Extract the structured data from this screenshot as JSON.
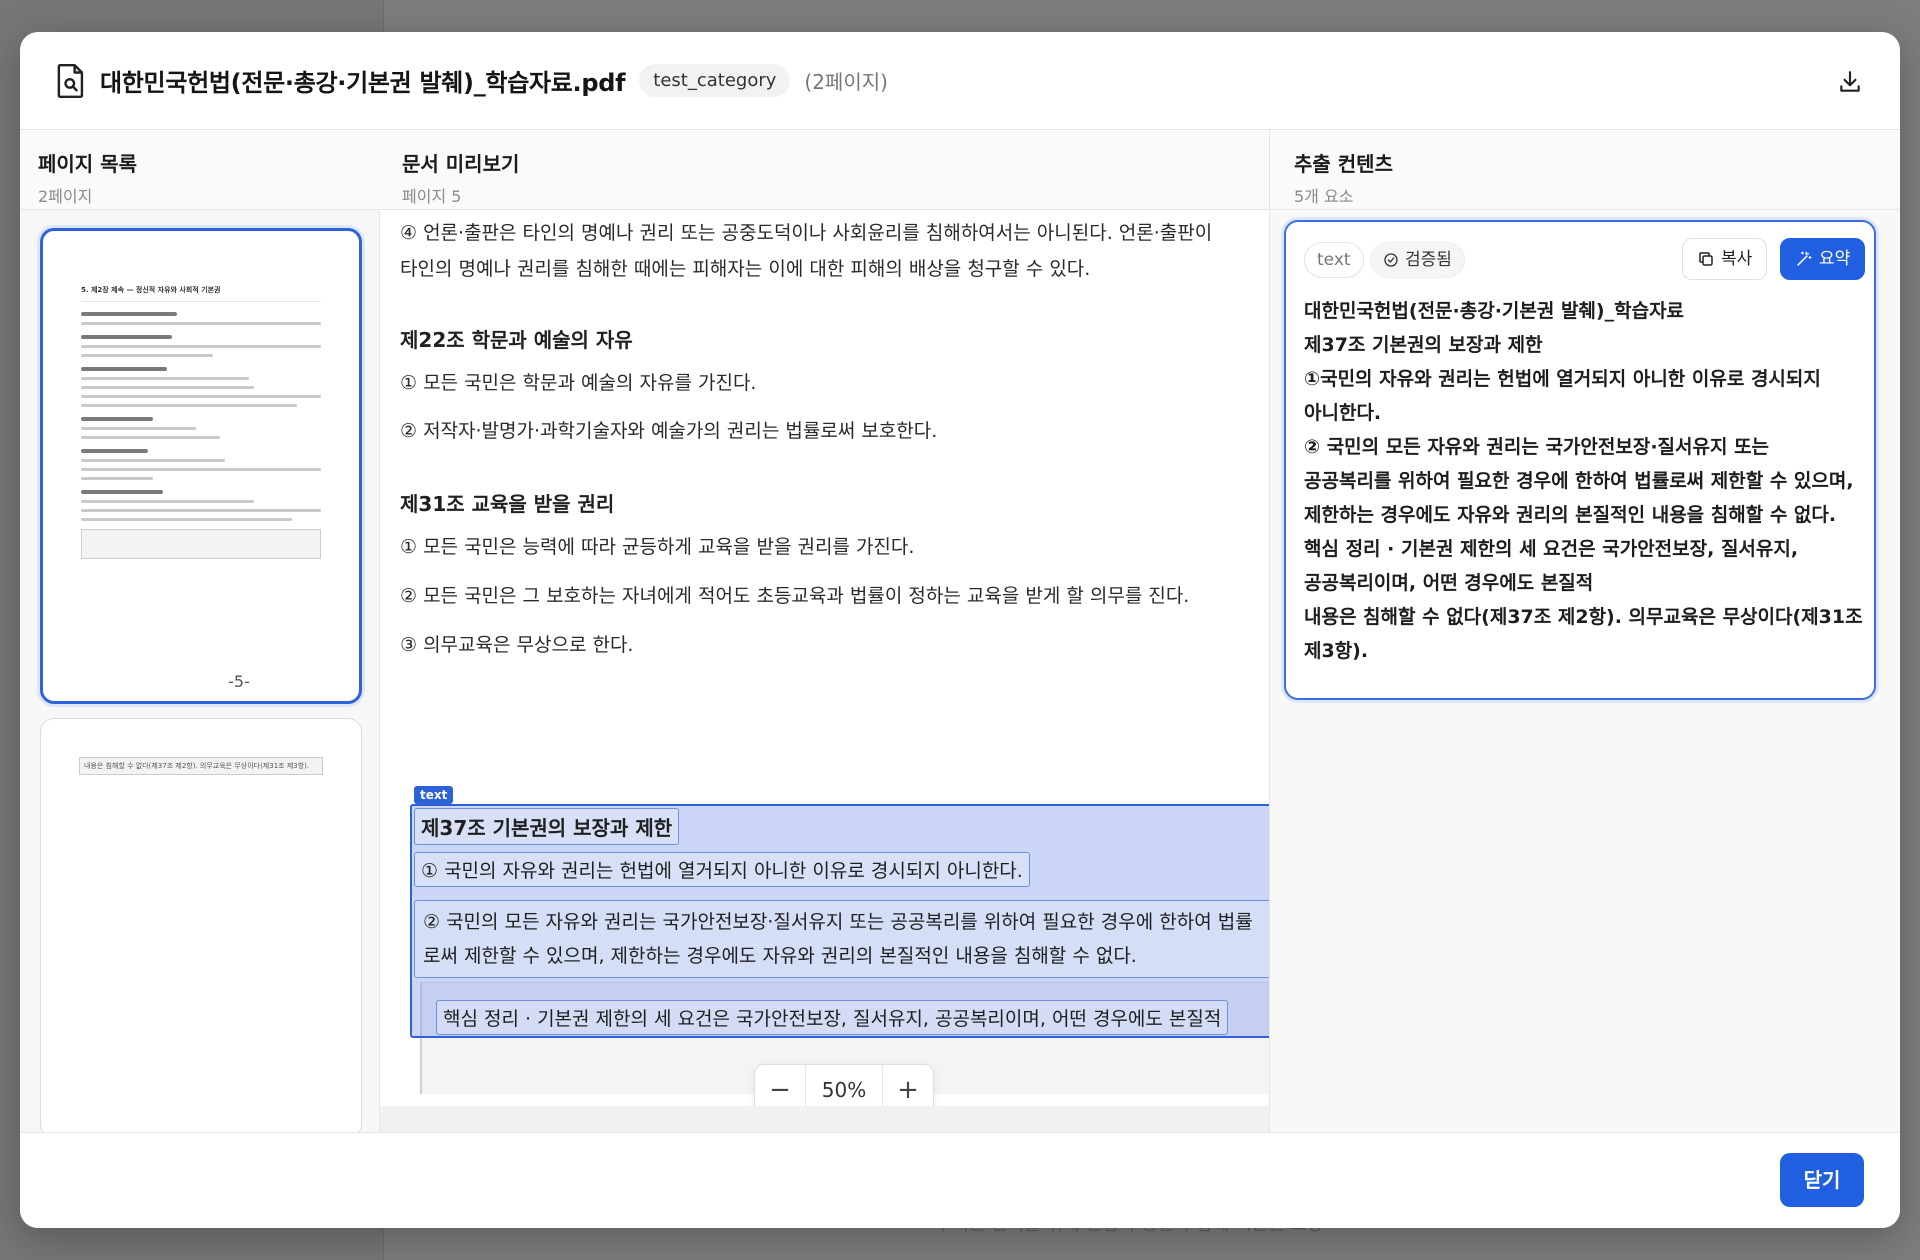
{
  "backdrop": {
    "bottom_text": "이 기본 원리를 위해 헌법의 정신과 함께 기본권 보장"
  },
  "header": {
    "file_title": "대한민국헌법(전문·총강·기본권 발췌)_학습자료.pdf",
    "category": "test_category",
    "page_count": "(2페이지)"
  },
  "left": {
    "title": "페이지 목록",
    "subtitle": "2페이지",
    "thumbs": [
      {
        "page_label": "-5-",
        "heading": "5. 제2장 제속 — 정신적 자유와 사회적 기본권"
      },
      {
        "caption": "내용은 침해할 수 없다(제37조 제2항). 의무교육은 무상이다(제31조 제3항)."
      }
    ]
  },
  "middle": {
    "title": "문서 미리보기",
    "subtitle": "페이지 5",
    "lines": {
      "l1": "④ 언론·출판은 타인의 명예나 권리 또는 공중도덕이나 사회윤리를 침해하여서는 아니된다. 언론·출판이",
      "l2": "타인의 명예나 권리를 침해한 때에는 피해자는 이에 대한 피해의 배상을 청구할 수 있다.",
      "a22": "제22조 학문과 예술의 자유",
      "a22_1": "① 모든 국민은 학문과 예술의 자유를 가진다.",
      "a22_2": "② 저작자·발명가·과학기술자와 예술가의 권리는 법률로써 보호한다.",
      "a31": "제31조 교육을 받을 권리",
      "a31_1": "① 모든 국민은 능력에 따라 균등하게 교육을 받을 권리를 가진다.",
      "a31_2": "② 모든 국민은 그 보호하는 자녀에게 적어도 초등교육과 법률이 정하는 교육을 받게 할 의무를 진다.",
      "a31_3": "③ 의무교육은 무상으로 한다.",
      "sel_tag": "text",
      "a37": "제37조 기본권의 보장과 제한",
      "a37_1": "① 국민의 자유와 권리는 헌법에 열거되지 아니한 이유로 경시되지 아니한다.",
      "a37_2a": "② 국민의 모든 자유와 권리는 국가안전보장·질서유지 또는 공공복리를 위하여 필요한 경우에 한하여 법률",
      "a37_2b": "로써 제한할 수 있으며, 제한하는 경우에도 자유와 권리의 본질적인 내용을 침해할 수 없다.",
      "callout": "핵심 정리 · 기본권 제한의 세 요건은 국가안전보장, 질서유지, 공공복리이며, 어떤 경우에도 본질적"
    },
    "zoom": {
      "minus": "−",
      "value": "50%",
      "plus": "+"
    }
  },
  "right": {
    "title": "추출 컨텐츠",
    "subtitle": "5개 요소",
    "card": {
      "type_chip": "text",
      "verified_chip": "검증됨",
      "copy_label": "복사",
      "summary_label": "요약",
      "content": [
        "대한민국헌법(전문·총강·기본권 발췌)_학습자료",
        "제37조 기본권의 보장과 제한",
        "①국민의 자유와 권리는 헌법에 열거되지 아니한 이유로 경시되지",
        "아니한다.",
        "② 국민의 모든 자유와 권리는 국가안전보장·질서유지 또는",
        "공공복리를 위하여 필요한 경우에 한하여 법률로써 제한할 수 있으며,",
        "제한하는 경우에도 자유와 권리의 본질적인 내용을 침해할 수 없다.",
        "핵심 정리 · 기본권 제한의 세 요건은 국가안전보장, 질서유지,",
        "공공복리이며, 어떤 경우에도 본질적",
        "내용은 침해할 수 없다(제37조 제2항). 의무교육은 무상이다(제31조",
        "제3항)."
      ]
    }
  },
  "footer": {
    "close_label": "닫기"
  },
  "colors": {
    "accent": "#1f5fe0",
    "selection": "#2d62d8"
  }
}
